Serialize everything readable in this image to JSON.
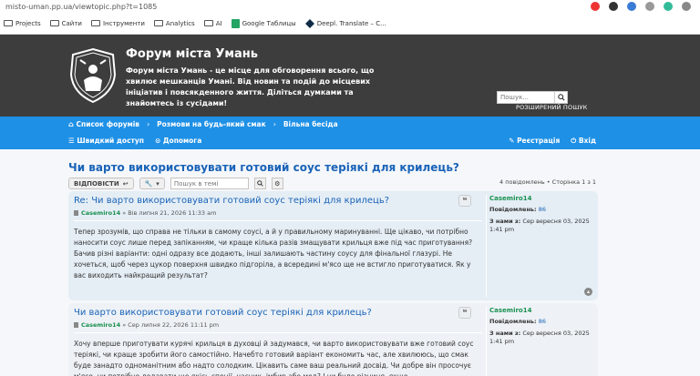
{
  "browser": {
    "url": "misto-uman.pp.ua/viewtopic.php?t=1085",
    "bookmarks": [
      {
        "label": "Projects"
      },
      {
        "label": "Сайти"
      },
      {
        "label": "Інструменти"
      },
      {
        "label": "Analytics"
      },
      {
        "label": "AI"
      },
      {
        "label": "Google Таблицы"
      },
      {
        "label": "Deepl. Translate – C..."
      }
    ]
  },
  "header": {
    "title": "Форум міста Умань",
    "description": "Форум міста Умань - це місце для обговорення всього, що хвилює мешканців Умані. Від новин та подій до місцевих ініціатив і повсякденного життя. Діліться думками та знайомтесь із сусідами!",
    "search_placeholder": "Пошук...",
    "advanced_search": "РОЗШИРЕНИЙ ПОШУК"
  },
  "nav": {
    "crumbs": [
      "Список форумів",
      "Розмови на будь-який смак",
      "Вільна бесіда"
    ],
    "quick_access": "Швидкий доступ",
    "help": "Допомога",
    "register": "Реєстрація",
    "login": "Вхід"
  },
  "topic": {
    "title": "Чи варто використовувати готовий соус теріякі для крилець?",
    "reply_button": "ВІДПОВІСТИ",
    "search_placeholder": "Пошук в темі",
    "pagination": "4 повідомлень • Сторінка 1 з 1",
    "posts": [
      {
        "subject": "Re: Чи варто використовувати готовий соус теріякі для крилець?",
        "author": "Casemiro14",
        "date": "Вів липня 21, 2026 11:33 am",
        "text": "Тепер зрозумів, що справа не тільки в самому соусі, а й у правильному маринуванні. Ще цікаво, чи потрібно наносити соус лише перед запіканням, чи краще кілька разів змащувати крильця вже під час приготування? Бачив різні варіанти: одні одразу все додають, інші залишають частину соусу для фінальної глазурі. Не хочеться, щоб через цукор поверхня швидко підгоріла, а всередині м'ясо ще не встигло приготуватися. Як у вас виходить найкращий результат?",
        "profile_name": "Casemiro14",
        "posts_label": "Повідомлень:",
        "posts_count": "86",
        "joined_label": "З нами з:",
        "joined": "Сер вересня 03, 2025 1:41 pm"
      },
      {
        "subject": "Чи варто використовувати готовий соус теріякі для крилець?",
        "author": "Casemiro14",
        "date": "Сер липня 22, 2026 11:11 pm",
        "text": "Хочу вперше приготувати курячі крильця в духовці й задумався, чи варто використовувати вже готовий соус теріякі, чи краще зробити його самостійно. Начебто готовий варіант економить час, але хвилююсь, що смак буде занадто одноманітним або надто солодким. Цікавить саме ваш реальний досвід. Чи добре він просочує м'ясо, чи потрібно додавати ще якісь спеції, часник, імбир або мед? І чи буде різниця, якщо",
        "profile_name": "Casemiro14",
        "posts_label": "Повідомлень:",
        "posts_count": "86",
        "joined_label": "З нами з:",
        "joined": "Сер вересня 03, 2025 1:41 pm"
      }
    ]
  },
  "colors": {
    "header_bg": "#3d3d3d",
    "nav_bg": "#1e90e6",
    "link": "#1a63b8",
    "author": "#1a9050"
  }
}
